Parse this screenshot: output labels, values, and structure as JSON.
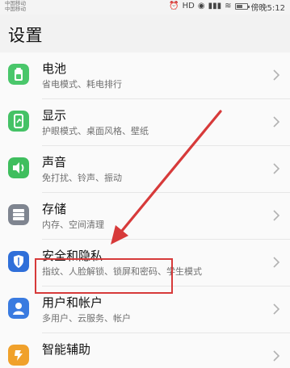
{
  "status_bar": {
    "carrier_1": "中国移动",
    "carrier_2": "中国移动",
    "alarm_icon": "alarm-icon",
    "hd_badge": "HD",
    "eye_icon": "eye-icon",
    "signal_icon": "signal-icon",
    "wifi_icon": "wifi-icon",
    "battery_level_percent": 55,
    "time": "傍晚5:12"
  },
  "page": {
    "title": "设置"
  },
  "settings": {
    "items": [
      {
        "title": "电池",
        "subtitle": "省电模式、耗电排行",
        "icon": "battery-icon",
        "icon_color": "#4ac76b"
      },
      {
        "title": "显示",
        "subtitle": "护眼模式、桌面风格、壁纸",
        "icon": "display-icon",
        "icon_color": "#45c266"
      },
      {
        "title": "声音",
        "subtitle": "免打扰、铃声、振动",
        "icon": "sound-icon",
        "icon_color": "#3fbe5e"
      },
      {
        "title": "存储",
        "subtitle": "内存、空间清理",
        "icon": "storage-icon",
        "icon_color": "#7f8590"
      },
      {
        "title": "安全和隐私",
        "subtitle": "指纹、人脸解锁、锁屏和密码、学生模式",
        "icon": "shield-icon",
        "icon_color": "#2f6fd9"
      },
      {
        "title": "用户和帐户",
        "subtitle": "多用户、云服务、帐户",
        "icon": "user-icon",
        "icon_color": "#3a7be0"
      },
      {
        "title": "智能辅助",
        "subtitle": "",
        "icon": "assist-icon",
        "icon_color": "#f0a12b"
      }
    ]
  },
  "annotation": {
    "arrow_color": "#d73a3a",
    "highlight_color": "#d73a3a"
  }
}
